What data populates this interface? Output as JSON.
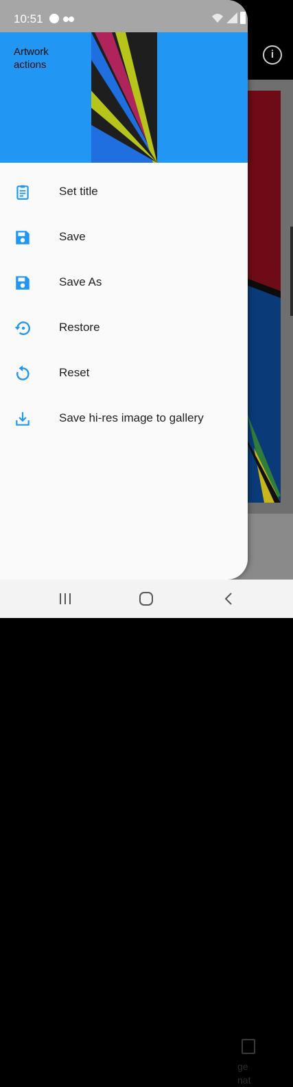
{
  "status_bar": {
    "time": "10:51",
    "icons": [
      "face-icon",
      "dots-icon",
      "wifi-icon",
      "signal-icon",
      "battery-icon"
    ]
  },
  "background_app": {
    "info_icon": "info-icon",
    "bottom_item_label": "Change\nformat",
    "bottom_item_label_visible": "ge\nnat"
  },
  "drawer": {
    "header_title": "Artwork actions",
    "header_color": "#2196f3",
    "items": [
      {
        "label": "Set title",
        "icon": "clipboard-icon"
      },
      {
        "label": "Save",
        "icon": "save-icon"
      },
      {
        "label": "Save As",
        "icon": "save-as-icon"
      },
      {
        "label": "Restore",
        "icon": "restore-icon"
      },
      {
        "label": "Reset",
        "icon": "reset-icon"
      },
      {
        "label": "Save hi-res image to gallery",
        "icon": "download-icon"
      }
    ],
    "icon_color": "#2196f3"
  },
  "nav_bar": {
    "buttons": [
      "recent-apps-icon",
      "home-icon",
      "back-icon"
    ]
  }
}
